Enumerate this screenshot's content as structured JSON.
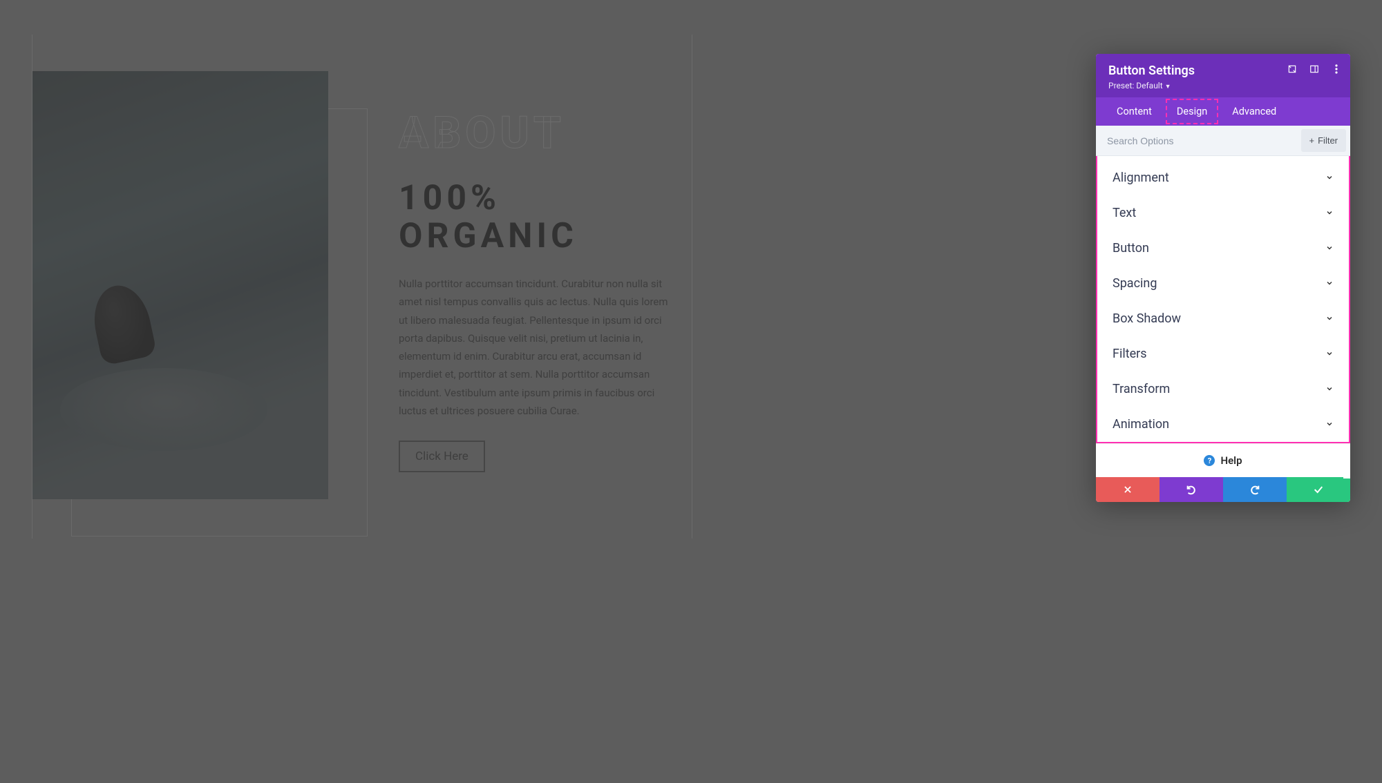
{
  "page": {
    "about_outline": "ABOUT",
    "headline_line1": "100%",
    "headline_line2": "ORGANIC",
    "body": "Nulla porttitor accumsan tincidunt. Curabitur non nulla sit amet nisl tempus convallis quis ac lectus. Nulla quis lorem ut libero malesuada feugiat. Pellentesque in ipsum id orci porta dapibus. Quisque velit nisi, pretium ut lacinia in, elementum id enim. Curabitur arcu erat, accumsan id imperdiet et, porttitor at sem. Nulla porttitor accumsan tincidunt. Vestibulum ante ipsum primis in faucibus orci luctus et ultrices posuere cubilia Curae.",
    "cta": "Click Here"
  },
  "panel": {
    "title": "Button Settings",
    "preset_label": "Preset: Default",
    "tabs": {
      "content": "Content",
      "design": "Design",
      "advanced": "Advanced"
    },
    "search_placeholder": "Search Options",
    "filter_label": "Filter",
    "sections": [
      "Alignment",
      "Text",
      "Button",
      "Spacing",
      "Box Shadow",
      "Filters",
      "Transform",
      "Animation"
    ],
    "help": "Help"
  }
}
